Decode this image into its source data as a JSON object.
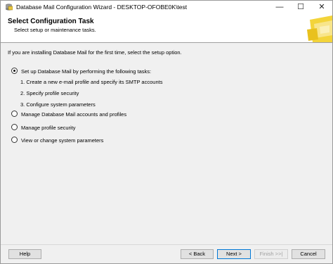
{
  "window": {
    "title": "Database Mail Configuration Wizard - DESKTOP-OFOBE0K\\test",
    "controls": {
      "minimize": "—",
      "maximize": "☐",
      "close": "✕"
    }
  },
  "header": {
    "title": "Select Configuration Task",
    "subtitle": "Select setup or maintenance tasks."
  },
  "intro": "If you are installing Database Mail for the first time, select the setup option.",
  "options": [
    {
      "label": "Set up Database Mail by performing the following tasks:",
      "selected": true
    },
    {
      "label": "Manage Database Mail accounts and profiles",
      "selected": false
    },
    {
      "label": "Manage profile security",
      "selected": false
    },
    {
      "label": "View or change system parameters",
      "selected": false
    }
  ],
  "steps": [
    "1. Create a new e-mail profile and specify its SMTP accounts",
    "2. Specify profile security",
    "3. Configure system parameters"
  ],
  "buttons": {
    "help": "Help",
    "back": "< Back",
    "next": "Next >",
    "finish": "Finish >>|",
    "cancel": "Cancel"
  },
  "icons": {
    "app": "database-mail-icon",
    "header_graphic": "wizard-header-graphic"
  },
  "colors": {
    "accent": "#0078d7",
    "header_graphic": "#f3d43a"
  }
}
